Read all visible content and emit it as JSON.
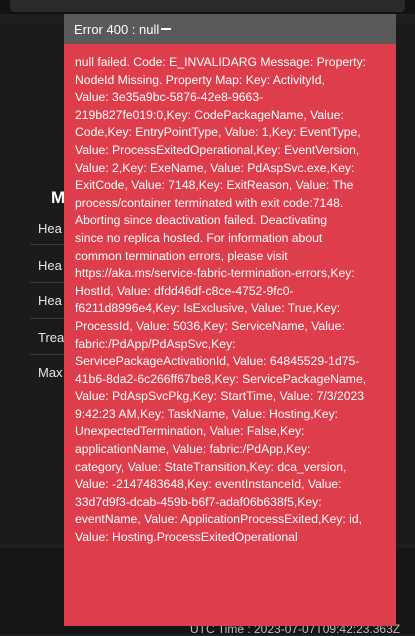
{
  "background": {
    "section_title": "M",
    "rows": [
      "Hea",
      "Hea",
      "Hea",
      "Trea",
      "Max"
    ],
    "bottom_text": "UTC Time : 2023-07-07T09:42:23.363Z"
  },
  "toast": {
    "title": "Error 400 : null",
    "lines": [
      "null failed. Code: E_INVALIDARG Message: Property:",
      "NodeId Missing. Property Map: Key: ActivityId,",
      "Value: 3e35a9bc-5876-42e8-9663-",
      "219b827fe019:0,Key: CodePackageName, Value:",
      "Code,Key: EntryPointType, Value: 1,Key: EventType,",
      "Value: ProcessExitedOperational,Key: EventVersion,",
      "Value: 2,Key: ExeName, Value: PdAspSvc.exe,Key:",
      "ExitCode, Value: 7148,Key: ExitReason, Value: The",
      "process/container terminated with exit code:7148.",
      "Aborting since deactivation failed. Deactivating",
      "since no replica hosted. For information about",
      "common termination errors, please visit",
      "https://aka.ms/service-fabric-termination-errors,Key:",
      "HostId, Value: dfdd46df-c8ce-4752-9fc0-",
      "f6211d8996e4,Key: IsExclusive, Value: True,Key:",
      "ProcessId, Value: 5036,Key: ServiceName, Value:",
      "fabric:/PdApp/PdAspSvc,Key:",
      "ServicePackageActivationId, Value: 64845529-1d75-",
      "41b6-8da2-6c266ff67be8,Key: ServicePackageName,",
      "Value: PdAspSvcPkg,Key: StartTime, Value: 7/3/2023",
      "9:42:23 AM,Key: TaskName, Value: Hosting,Key:",
      "UnexpectedTermination, Value: False,Key:",
      "applicationName, Value: fabric:/PdApp,Key:",
      "category, Value: StateTransition,Key: dca_version,",
      "Value: -2147483648,Key: eventInstanceId, Value:",
      "33d7d9f3-dcab-459b-b6f7-adaf06b638f5,Key:",
      "eventName, Value: ApplicationProcessExited,Key: id,",
      "Value: Hosting.ProcessExitedOperational"
    ]
  }
}
